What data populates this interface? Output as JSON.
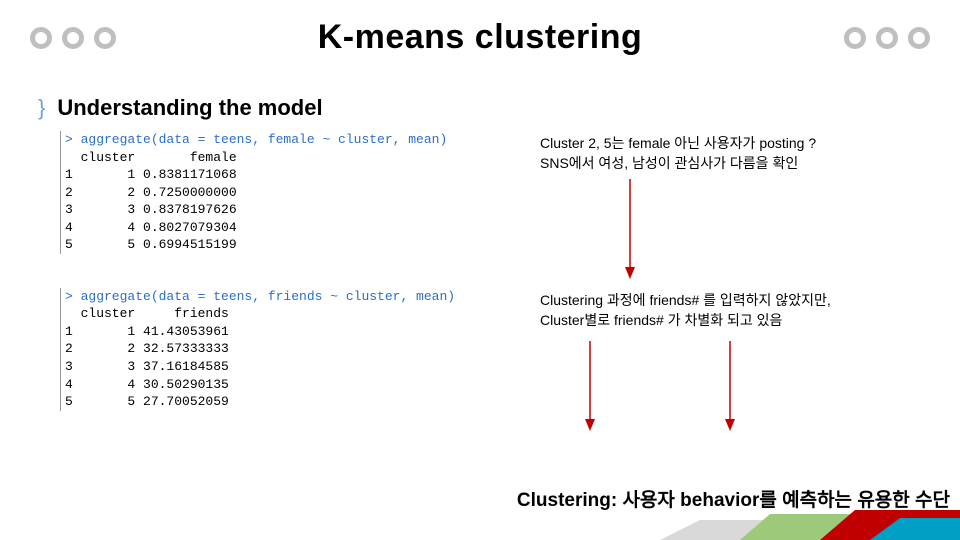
{
  "title": "K-means clustering",
  "section_heading": "Understanding the model",
  "bullet_brace": "}",
  "block1": {
    "code_prompt": "> aggregate(data = teens, female ~ cluster, mean)",
    "code_header": "  cluster       female",
    "rows": [
      "1       1 0.8381171068",
      "2       2 0.7250000000",
      "3       3 0.8378197626",
      "4       4 0.8027079304",
      "5       5 0.6994515199"
    ],
    "annotation_line1": "Cluster 2, 5는  female 아닌 사용자가 posting ?",
    "annotation_line2": "SNS에서 여성, 남성이 관심사가 다름을 확인"
  },
  "block2": {
    "code_prompt": "> aggregate(data = teens, friends ~ cluster, mean)",
    "code_header": "  cluster     friends",
    "rows": [
      "1       1 41.43053961",
      "2       2 32.57333333",
      "3       3 37.16184585",
      "4       4 30.50290135",
      "5       5 27.70052059"
    ],
    "annotation_line1": "Clustering 과정에 friends# 를 입력하지 않았지만,",
    "annotation_line2": "Cluster별로 friends# 가 차별화 되고 있음"
  },
  "conclusion": "Clustering: 사용자 behavior를 예측하는 유용한 수단",
  "colors": {
    "arrow": "#c00000",
    "code_prompt": "#2a6ec9"
  }
}
